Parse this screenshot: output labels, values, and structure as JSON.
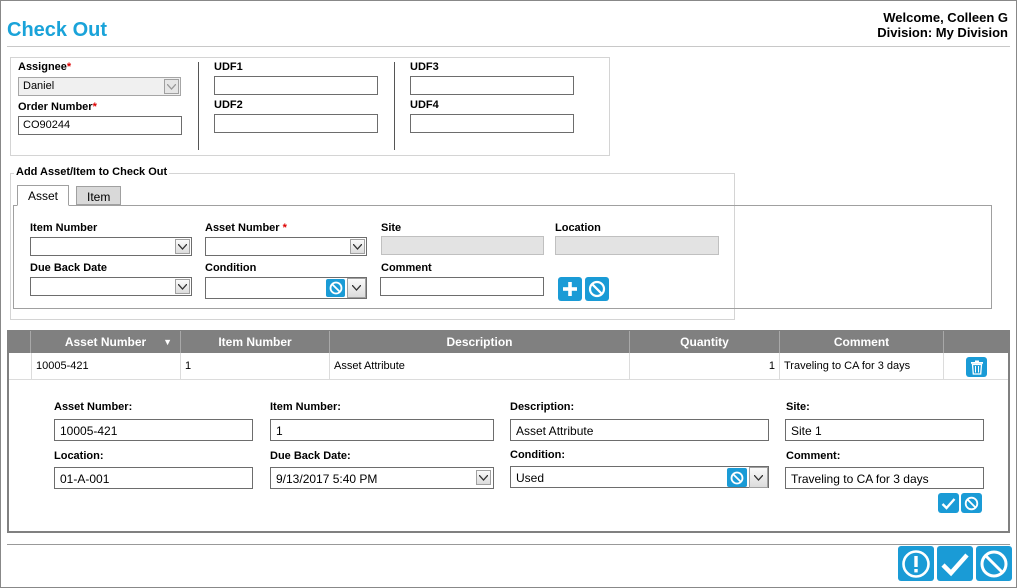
{
  "header": {
    "title": "Check Out",
    "welcome": "Welcome, Colleen G",
    "division": "Division: My Division"
  },
  "top_form": {
    "assignee_label": "Assignee",
    "assignee_value": "Daniel",
    "order_label": "Order Number",
    "order_value": "CO90244",
    "udf1_label": "UDF1",
    "udf2_label": "UDF2",
    "udf3_label": "UDF3",
    "udf4_label": "UDF4",
    "udf1_value": "",
    "udf2_value": "",
    "udf3_value": "",
    "udf4_value": ""
  },
  "add_section": {
    "legend": "Add Asset/Item to Check Out",
    "tabs": [
      {
        "label": "Asset",
        "active": true
      },
      {
        "label": "Item",
        "active": false
      }
    ],
    "item_number_label": "Item Number",
    "asset_number_label": "Asset Number",
    "site_label": "Site",
    "location_label": "Location",
    "due_back_label": "Due Back Date",
    "condition_label": "Condition",
    "comment_label": "Comment",
    "item_number_value": "",
    "asset_number_value": "",
    "site_value": "",
    "location_value": "",
    "due_back_value": "",
    "condition_value": "",
    "comment_value": ""
  },
  "grid": {
    "columns": [
      "Asset Number",
      "Item Number",
      "Description",
      "Quantity",
      "Comment"
    ],
    "rows": [
      {
        "asset_number": "10005-421",
        "item_number": "1",
        "description": "Asset Attribute",
        "quantity": "1",
        "comment": "Traveling to CA for 3 days"
      }
    ]
  },
  "edit_row": {
    "asset_number_label": "Asset Number:",
    "asset_number_value": "10005-421",
    "item_number_label": "Item Number:",
    "item_number_value": "1",
    "description_label": "Description:",
    "description_value": "Asset Attribute",
    "site_label": "Site:",
    "site_value": "Site 1",
    "location_label": "Location:",
    "location_value": "01-A-001",
    "due_back_label": "Due Back Date:",
    "due_back_value": "9/13/2017 5:40 PM",
    "condition_label": "Condition:",
    "condition_value": "Used",
    "comment_label": "Comment:",
    "comment_value": "Traveling to CA for 3 days"
  },
  "icons": {
    "accent": "#1a9bd6",
    "title_color": "#1aa3d9",
    "required_color": "#dd0000"
  }
}
